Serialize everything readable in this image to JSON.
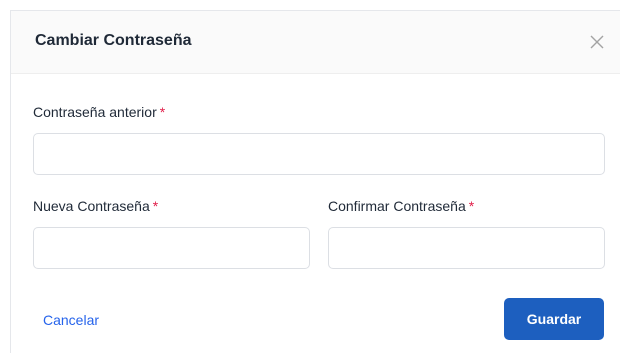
{
  "dialog": {
    "title": "Cambiar Contraseña",
    "close_icon": "close-icon"
  },
  "form": {
    "old_password": {
      "label": "Contraseña anterior",
      "required_mark": "*",
      "value": "",
      "placeholder": ""
    },
    "new_password": {
      "label": "Nueva Contraseña",
      "required_mark": "*",
      "value": "",
      "placeholder": ""
    },
    "confirm_password": {
      "label": "Confirmar Contraseña",
      "required_mark": "*",
      "value": "",
      "placeholder": ""
    }
  },
  "actions": {
    "cancel_label": "Cancelar",
    "save_label": "Guardar"
  },
  "colors": {
    "primary": "#1d5fbf",
    "link": "#2563eb",
    "required": "#e11d48",
    "header_bg": "#fafafa"
  }
}
